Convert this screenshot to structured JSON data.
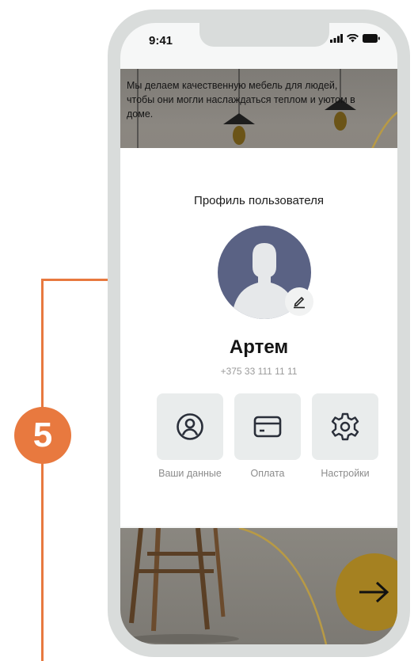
{
  "annotation": {
    "step_number": "5",
    "accent_color": "#e8793f"
  },
  "status_bar": {
    "time": "9:41"
  },
  "hero": {
    "text": "Мы делаем качественную мебель для людей, чтобы они могли наслаждаться теплом и уютом в доме."
  },
  "profile": {
    "title": "Профиль пользователя",
    "name": "Артем",
    "phone": "+375 33 111 11 11"
  },
  "actions": [
    {
      "label": "Ваши данные",
      "icon": "user-circle-icon"
    },
    {
      "label": "Оплата",
      "icon": "credit-card-icon"
    },
    {
      "label": "Настройки",
      "icon": "gear-icon"
    }
  ],
  "colors": {
    "avatar_bg": "#5a6284",
    "next_button": "#a58121",
    "tile_bg": "#e9ecec"
  }
}
